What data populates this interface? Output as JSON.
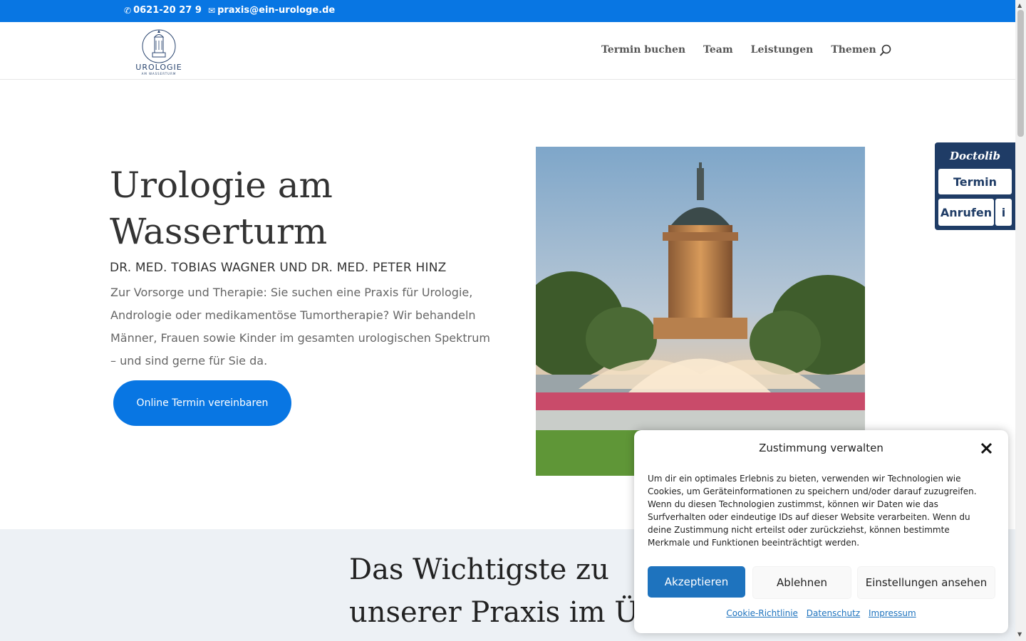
{
  "topbar": {
    "phone": "0621-20 27 9",
    "email": "praxis@ein-urologe.de"
  },
  "header": {
    "logo_text": "UROLOGIE",
    "logo_sub": "AM WASSERTURM",
    "nav": [
      "Termin buchen",
      "Team",
      "Leistungen",
      "Themen"
    ]
  },
  "hero": {
    "title": "Urologie am Wasserturm",
    "subtitle": "DR. MED. TOBIAS WAGNER UND DR. MED. PETER HINZ",
    "text": "Zur Vorsorge und Therapie: Sie suchen eine Praxis für Urologie, Andrologie oder medikamentöse Tumortherapie? Wir behandeln Männer, Frauen sowie Kinder im gesamten urologischen Spektrum – und sind gerne für Sie da.",
    "cta": "Online Termin vereinbaren"
  },
  "doctolib": {
    "brand": "Doctolib",
    "termin": "Termin",
    "call": "Anrufen",
    "info": "i"
  },
  "lower": {
    "title": "Das Wichtigste zu unserer Praxis im Ü"
  },
  "cookie": {
    "title": "Zustimmung verwalten",
    "text": "Um dir ein optimales Erlebnis zu bieten, verwenden wir Technologien wie Cookies, um Geräteinformationen zu speichern und/oder darauf zuzugreifen. Wenn du diesen Technologien zustimmst, können wir Daten wie das Surfverhalten oder eindeutige IDs auf dieser Website verarbeiten. Wenn du deine Zustimmung nicht erteilst oder zurückziehst, können bestimmte Merkmale und Funktionen beeinträchtigt werden.",
    "accept": "Akzeptieren",
    "deny": "Ablehnen",
    "prefs": "Einstellungen ansehen",
    "links": [
      "Cookie-Richtlinie",
      "Datenschutz",
      "Impressum"
    ]
  },
  "colors": {
    "accent": "#0876e3",
    "doctolib": "#1f3c66",
    "cookie_accept": "#1e73be"
  }
}
